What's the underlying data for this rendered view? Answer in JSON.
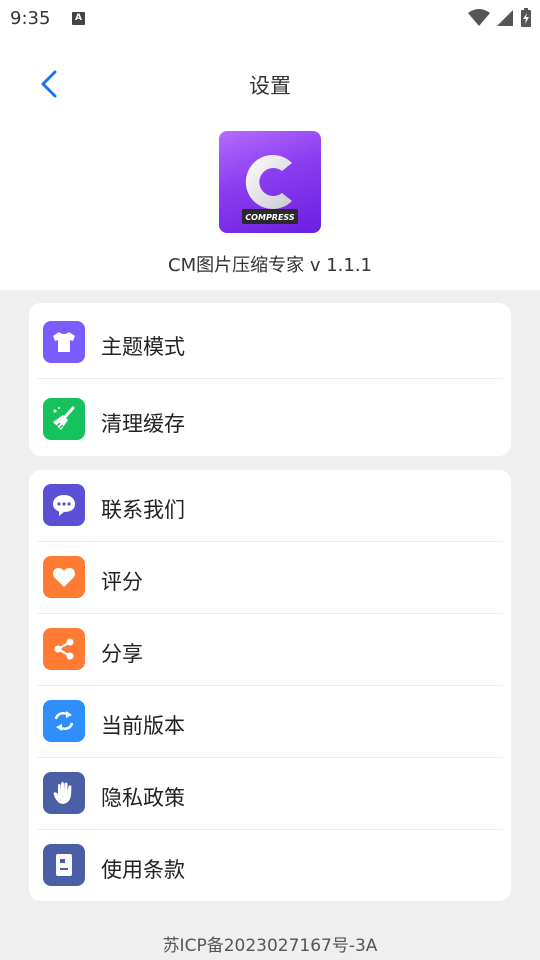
{
  "status": {
    "time": "9:35",
    "notif_letter": "A"
  },
  "header": {
    "title": "设置"
  },
  "app": {
    "logo_text": "COMPRESS",
    "logo_letter": "C",
    "name": "CM图片压缩专家 v 1.1.1"
  },
  "groups": [
    {
      "items": [
        {
          "label": "主题模式",
          "icon": "shirt-icon",
          "color": "#7b5cff"
        },
        {
          "label": "清理缓存",
          "icon": "broom-icon",
          "color": "#16c25e"
        }
      ]
    },
    {
      "items": [
        {
          "label": "联系我们",
          "icon": "chat-icon",
          "color": "#5b4fd6"
        },
        {
          "label": "评分",
          "icon": "heart-icon",
          "color": "#ff7a33"
        },
        {
          "label": "分享",
          "icon": "share-icon",
          "color": "#ff7a33"
        },
        {
          "label": "当前版本",
          "icon": "refresh-icon",
          "color": "#2e8ffb"
        },
        {
          "label": "隐私政策",
          "icon": "hand-icon",
          "color": "#4a5fa6"
        },
        {
          "label": "使用条款",
          "icon": "document-icon",
          "color": "#4a5fa6"
        }
      ]
    }
  ],
  "footer": {
    "icp": "苏ICP备2023027167号-3A"
  },
  "colors": {
    "accent": "#1a73e8",
    "background": "#efefef"
  }
}
